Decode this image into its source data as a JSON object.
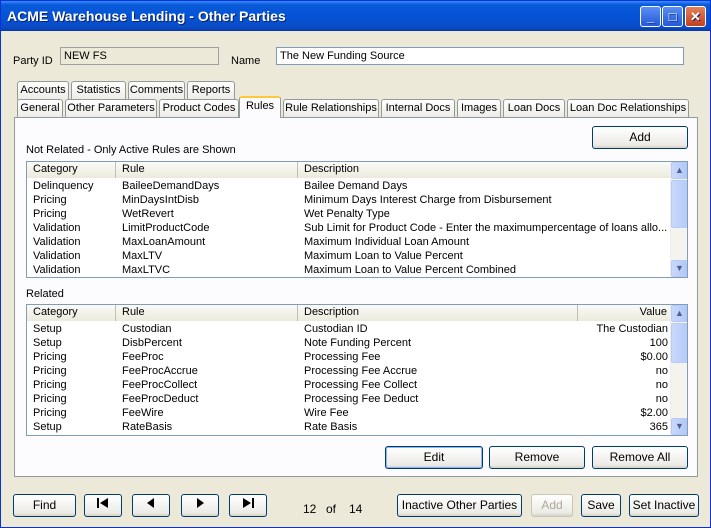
{
  "window": {
    "title": "ACME Warehouse Lending - Other Parties"
  },
  "party": {
    "id_label": "Party ID",
    "id_value": "NEW FS",
    "name_label": "Name",
    "name_value": "The New Funding Source"
  },
  "tabs_row1": [
    "Accounts",
    "Statistics",
    "Comments",
    "Reports"
  ],
  "tabs_row2": [
    "General",
    "Other Parameters",
    "Product Codes",
    "Rules",
    "Rule Relationships",
    "Internal Docs",
    "Images",
    "Loan Docs",
    "Loan Doc Relationships"
  ],
  "active_tab": "Rules",
  "not_related": {
    "caption": "Not Related - Only Active Rules are Shown",
    "add_label": "Add",
    "columns": [
      "Category",
      "Rule",
      "Description"
    ],
    "rows": [
      [
        "Delinquency",
        "BaileeDemandDays",
        "Bailee Demand Days"
      ],
      [
        "Pricing",
        "MinDaysIntDisb",
        "Minimum Days Interest Charge from Disbursement"
      ],
      [
        "Pricing",
        "WetRevert",
        "Wet Penalty Type"
      ],
      [
        "Validation",
        "LimitProductCode",
        "Sub Limit for Product Code - Enter the maximumpercentage of loans allo..."
      ],
      [
        "Validation",
        "MaxLoanAmount",
        "Maximum Individual Loan Amount"
      ],
      [
        "Validation",
        "MaxLTV",
        "Maximum Loan to Value Percent"
      ],
      [
        "Validation",
        "MaxLTVC",
        "Maximum Loan to Value Percent Combined"
      ]
    ]
  },
  "related": {
    "caption": "Related",
    "columns": [
      "Category",
      "Rule",
      "Description",
      "Value"
    ],
    "rows": [
      [
        "Setup",
        "Custodian",
        "Custodian ID",
        "The Custodian"
      ],
      [
        "Setup",
        "DisbPercent",
        "Note Funding Percent",
        "100"
      ],
      [
        "Pricing",
        "FeeProc",
        "Processing Fee",
        "$0.00"
      ],
      [
        "Pricing",
        "FeeProcAccrue",
        "Processing Fee Accrue",
        "no"
      ],
      [
        "Pricing",
        "FeeProcCollect",
        "Processing Fee Collect",
        "no"
      ],
      [
        "Pricing",
        "FeeProcDeduct",
        "Processing Fee Deduct",
        "no"
      ],
      [
        "Pricing",
        "FeeWire",
        "Wire Fee",
        "$2.00"
      ],
      [
        "Setup",
        "RateBasis",
        "Rate Basis",
        "365"
      ]
    ],
    "edit_label": "Edit",
    "remove_label": "Remove",
    "remove_all_label": "Remove All"
  },
  "footer": {
    "find_label": "Find",
    "record_current": "12",
    "record_of": "of",
    "record_total": "14",
    "inactive_parties_label": "Inactive Other Parties",
    "add_label": "Add",
    "save_label": "Save",
    "set_inactive_label": "Set Inactive"
  },
  "icons": {
    "first": "first-record-icon",
    "prev": "previous-record-icon",
    "next": "next-record-icon",
    "last": "last-record-icon"
  }
}
